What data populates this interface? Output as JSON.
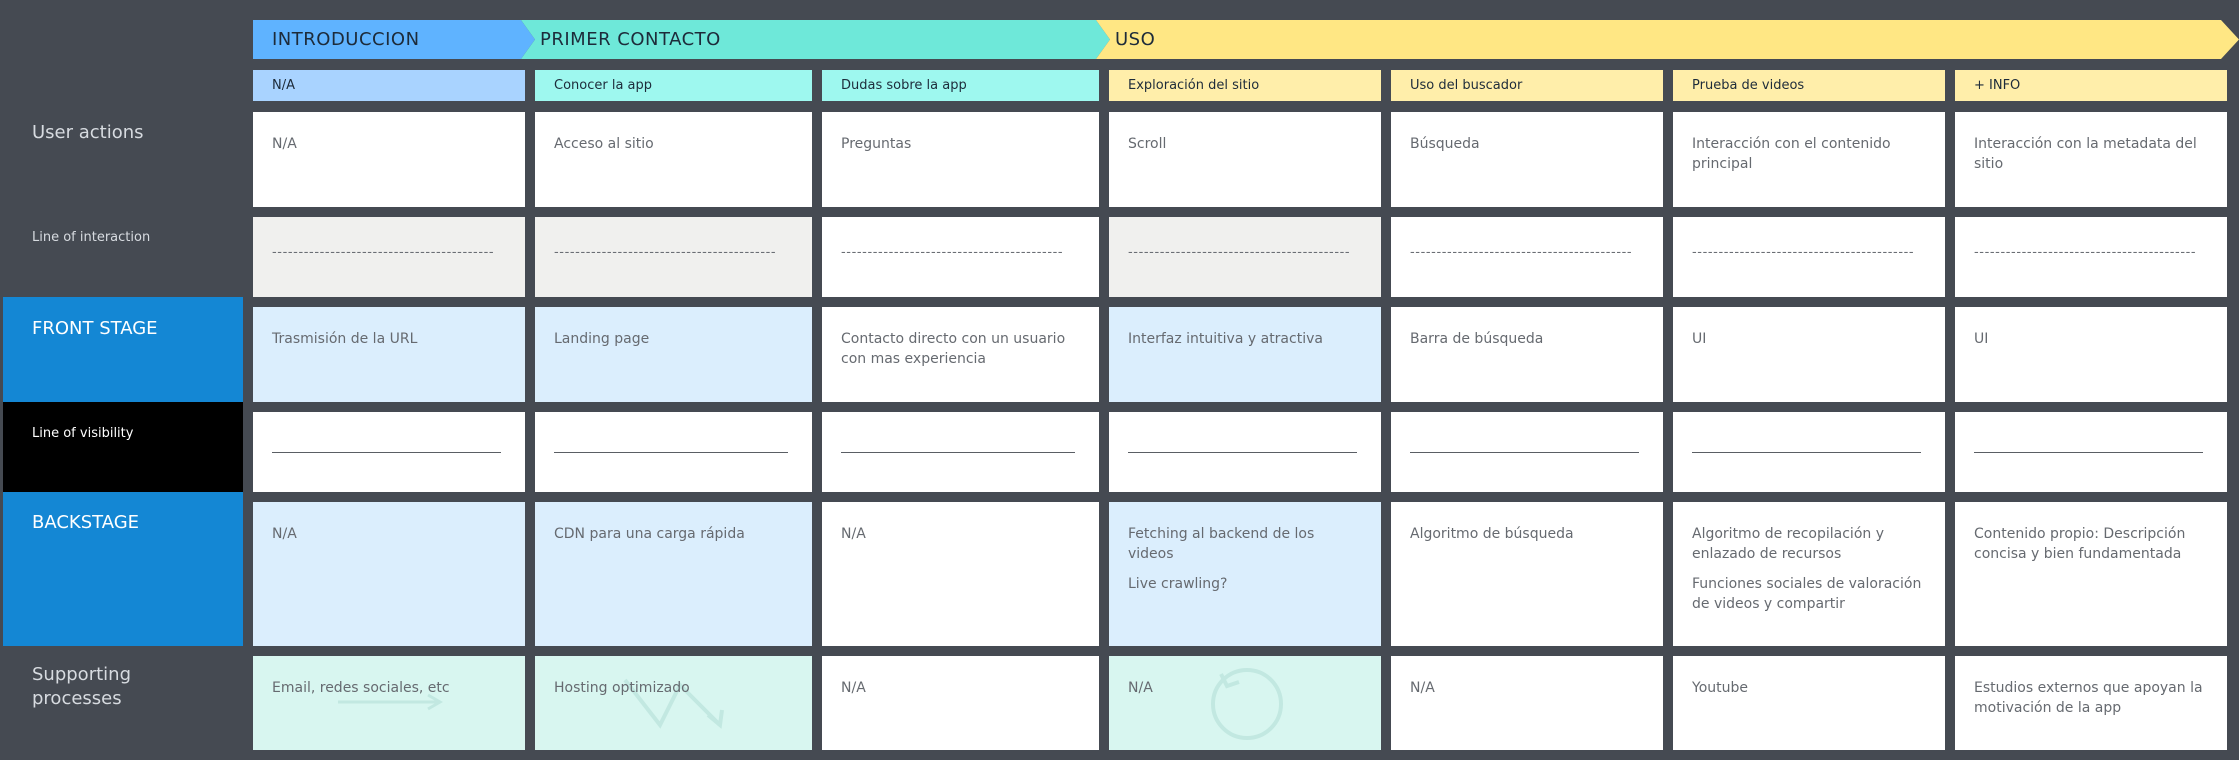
{
  "phases": [
    {
      "label": "INTRODUCCION"
    },
    {
      "label": "PRIMER CONTACTO"
    },
    {
      "label": "USO"
    }
  ],
  "steps": [
    "N/A",
    "Conocer la app",
    "Dudas sobre la app",
    "Exploración del sitio",
    "Uso del buscador",
    "Prueba de videos",
    "+ INFO"
  ],
  "lanes": {
    "user_actions": "User actions",
    "line_of_interaction": "Line of interaction",
    "front_stage": "FRONT STAGE",
    "line_of_visibility": "Line of visibility",
    "backstage": "BACKSTAGE",
    "supporting_processes": "Supporting processes"
  },
  "user_actions": [
    [
      "N/A"
    ],
    [
      "Acceso al sitio"
    ],
    [
      "Preguntas"
    ],
    [
      "Scroll"
    ],
    [
      "Búsqueda"
    ],
    [
      "Interacción con el contenido principal"
    ],
    [
      "Interacción con la metadata del sitio"
    ]
  ],
  "interaction_dashes": "------------------------------------------",
  "front_stage": [
    [
      "Trasmisión de la URL"
    ],
    [
      "Landing page"
    ],
    [
      "Contacto directo con un usuario con mas experiencia"
    ],
    [
      "Interfaz intuitiva y atractiva"
    ],
    [
      "Barra de búsqueda"
    ],
    [
      "UI"
    ],
    [
      "UI"
    ]
  ],
  "backstage": [
    [
      "N/A"
    ],
    [
      "CDN para una carga rápida"
    ],
    [
      "N/A"
    ],
    [
      "Fetching al backend de los videos",
      "Live crawling?"
    ],
    [
      "Algoritmo de búsqueda"
    ],
    [
      "Algoritmo de recopilación y enlazado de recursos",
      "Funciones sociales de valoración de videos y compartir"
    ],
    [
      "Contenido propio: Descripción concisa y bien fundamentada"
    ]
  ],
  "supporting": [
    [
      "Email, redes sociales, etc"
    ],
    [
      "Hosting optimizado"
    ],
    [
      "N/A"
    ],
    [
      "N/A"
    ],
    [
      "N/A"
    ],
    [
      "Youtube"
    ],
    [
      "Estudios externos que apoyan la motivación de la app"
    ]
  ],
  "colors": {
    "background": "#454a52",
    "intro_phase": "#5fb3ff",
    "contact_phase": "#6ee8d9",
    "uso_phase": "#ffe784",
    "stage_blue": "#1487d4",
    "visibility_black": "#000000",
    "tint_blue": "#dbeefd",
    "tint_green": "#d8f6f0",
    "tint_grey": "#f0f0ee"
  }
}
